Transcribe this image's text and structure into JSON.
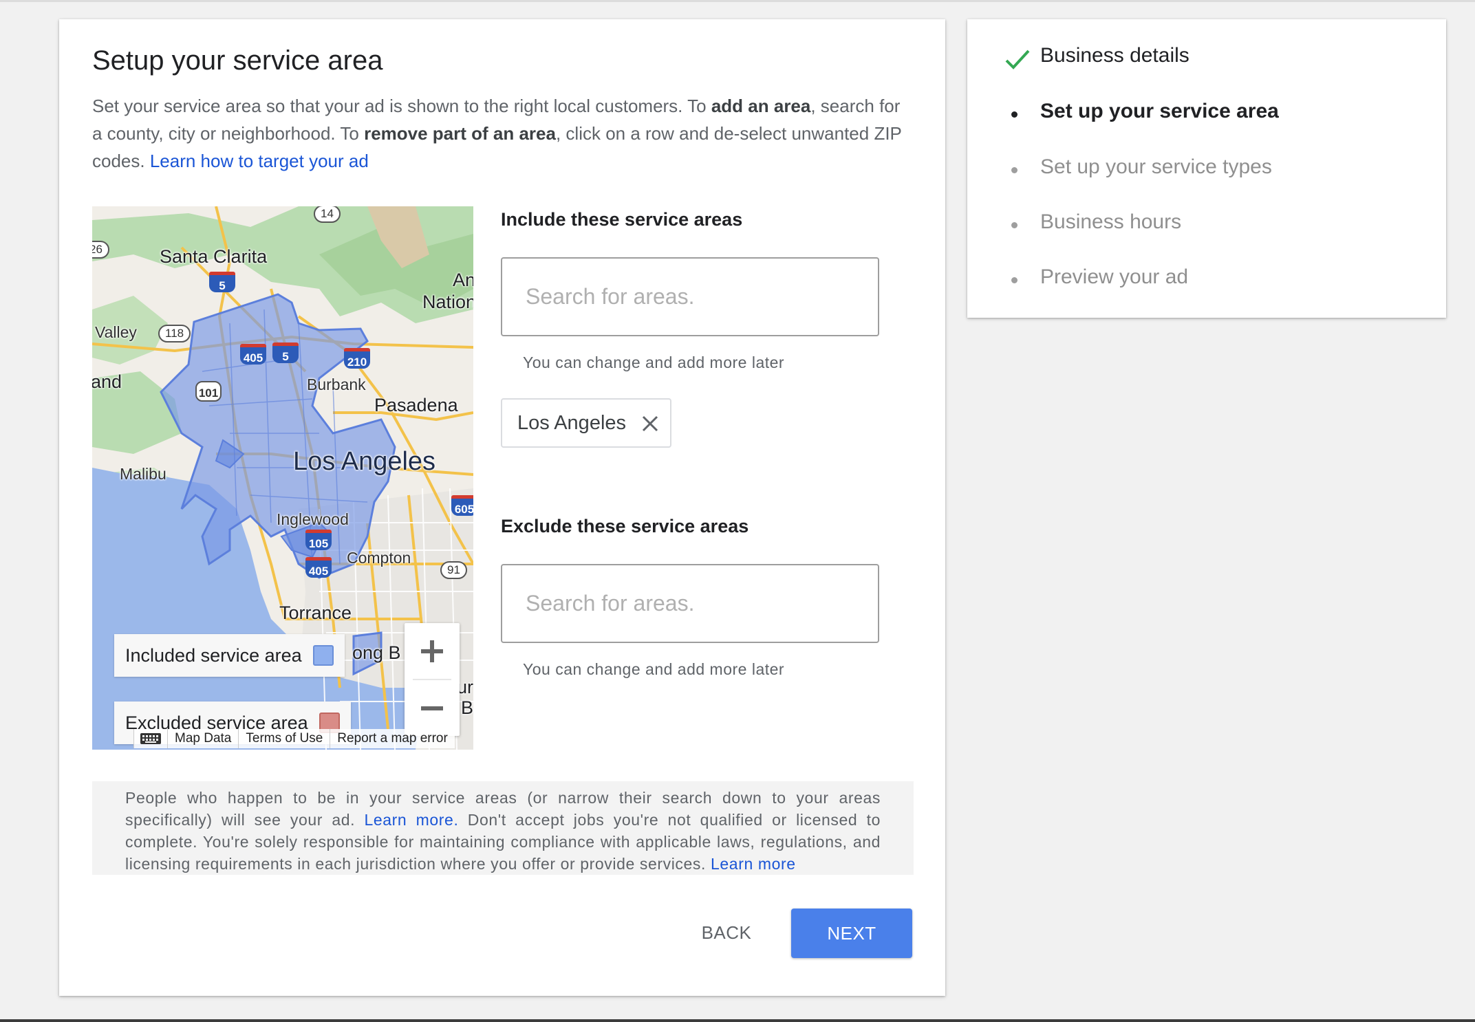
{
  "title": "Setup your service area",
  "intro": {
    "part1": "Set your service area so that your ad is shown to the right local customers. To ",
    "bold1": "add an area",
    "part2": ", search for a county, city or neighborhood. To ",
    "bold2": "remove part of an area",
    "part3": ", click on a row and de-select unwanted ZIP codes. ",
    "link": "Learn how to target your ad"
  },
  "map": {
    "labels": {
      "santa_clarita": "Santa Clarita",
      "valley": "Valley",
      "and": "and",
      "burbank": "Burbank",
      "pasadena": "Pasadena",
      "los_angeles": "Los Angeles",
      "malibu": "Malibu",
      "inglewood": "Inglewood",
      "compton": "Compton",
      "torrance": "Torrance",
      "long_beach": "ong B",
      "nation": "Nation",
      "an": "An",
      "ur": "ur",
      "b": "B"
    },
    "shields": [
      "5",
      "405",
      "5",
      "210",
      "101",
      "105",
      "405",
      "605"
    ],
    "ovals": [
      "14",
      "118",
      "91",
      "26"
    ],
    "legend": {
      "included_label": "Included service area",
      "included_color": "#8fb0ee",
      "excluded_label": "Excluded service area",
      "excluded_color": "#d98c87"
    },
    "zoom_in": "+",
    "zoom_out": "−",
    "attribution": {
      "keyboard_icon": "keyboard-icon",
      "map_data": "Map Data",
      "terms": "Terms of Use",
      "report": "Report a map error"
    }
  },
  "include": {
    "heading": "Include these service areas",
    "placeholder": "Search for areas.",
    "hint": "You can change and add more later",
    "chips": [
      {
        "label": "Los Angeles",
        "remove_icon": "close-icon"
      }
    ]
  },
  "exclude": {
    "heading": "Exclude these service areas",
    "placeholder": "Search for areas.",
    "hint": "You can change and add more later"
  },
  "notice": {
    "part1": "People who happen to be in your service areas (or narrow their search down to your areas specifically) will see your ad. ",
    "link1": "Learn more.",
    "part2": " Don't accept jobs you're not qualified or licensed to complete. You're solely responsible for maintaining compliance with applicable laws, regulations, and licensing requirements in each jurisdiction where you offer or provide services. ",
    "link2": "Learn more"
  },
  "buttons": {
    "back": "BACK",
    "next": "NEXT",
    "next_color": "#4a80ea"
  },
  "steps": [
    {
      "label": "Business details",
      "state": "done",
      "icon": "check-icon",
      "color": "#34a853"
    },
    {
      "label": "Set up your service area",
      "state": "active"
    },
    {
      "label": "Set up your service types",
      "state": "todo"
    },
    {
      "label": "Business hours",
      "state": "todo"
    },
    {
      "label": "Preview your ad",
      "state": "todo"
    }
  ]
}
